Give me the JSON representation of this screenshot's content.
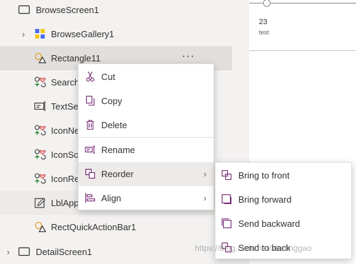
{
  "tree": {
    "items": [
      {
        "label": "BrowseScreen1",
        "icon": "screen-icon",
        "chevron": ""
      },
      {
        "label": "BrowseGallery1",
        "icon": "gallery-icon",
        "chevron": "›"
      },
      {
        "label": "Rectangle11",
        "icon": "shape-icon",
        "chevron": "",
        "more": "···"
      },
      {
        "label": "Search",
        "icon": "icon-control-icon",
        "chevron": ""
      },
      {
        "label": "TextSea",
        "icon": "text-input-icon",
        "chevron": ""
      },
      {
        "label": "IconNe",
        "icon": "icon-control-icon",
        "chevron": ""
      },
      {
        "label": "IconSo",
        "icon": "icon-control-icon",
        "chevron": ""
      },
      {
        "label": "IconRe",
        "icon": "icon-control-icon",
        "chevron": ""
      },
      {
        "label": "LblApp",
        "icon": "label-edit-icon",
        "chevron": ""
      },
      {
        "label": "RectQuickActionBar1",
        "icon": "shape-icon",
        "chevron": ""
      },
      {
        "label": "DetailScreen1",
        "icon": "screen-icon",
        "chevron": "›"
      }
    ]
  },
  "canvas": {
    "item_title": "23",
    "item_subtitle": "test"
  },
  "context_menu": {
    "items": [
      {
        "label": "Cut",
        "icon": "cut-icon"
      },
      {
        "label": "Copy",
        "icon": "copy-icon"
      },
      {
        "label": "Delete",
        "icon": "delete-icon"
      },
      {
        "label": "Rename",
        "icon": "rename-icon"
      },
      {
        "label": "Reorder",
        "icon": "reorder-icon",
        "arrow": "›"
      },
      {
        "label": "Align",
        "icon": "align-icon",
        "arrow": "›"
      }
    ]
  },
  "reorder_submenu": {
    "items": [
      {
        "label": "Bring to front",
        "icon": "bring-to-front-icon"
      },
      {
        "label": "Bring forward",
        "icon": "bring-forward-icon"
      },
      {
        "label": "Send backward",
        "icon": "send-backward-icon"
      },
      {
        "label": "Send to back",
        "icon": "send-to-back-icon"
      }
    ]
  },
  "watermark": "https://blog.csdn.net/aladinggao",
  "colors": {
    "accent": "#742774",
    "selected_row": "#e1dfdd",
    "menu_hover": "#edebe9"
  }
}
